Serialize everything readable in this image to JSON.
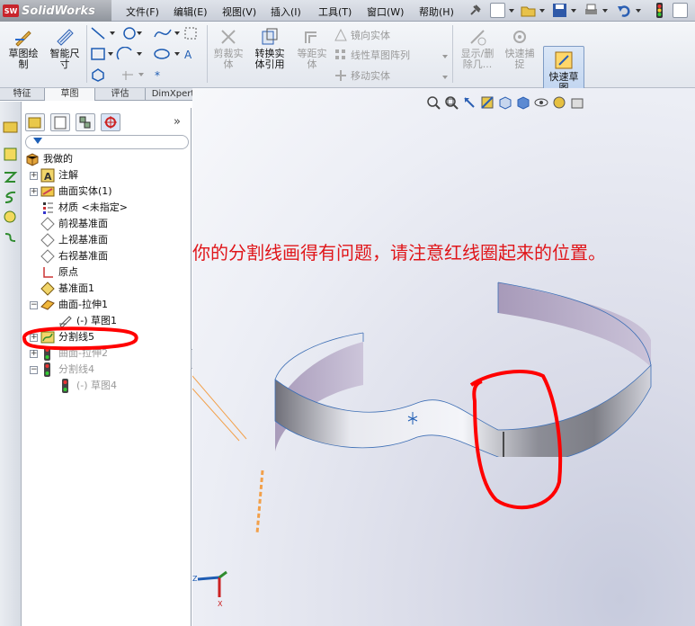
{
  "app": {
    "name": "SolidWorks",
    "logo_badge": "SW"
  },
  "menu": [
    "文件(F)",
    "编辑(E)",
    "视图(V)",
    "插入(I)",
    "工具(T)",
    "窗口(W)",
    "帮助(H)"
  ],
  "ribbon": {
    "sketch": "草图绘\n制",
    "smart_dim": "智能尺\n寸",
    "trim": "剪裁实\n体",
    "convert": "转换实\n体引用",
    "offset": "等距实\n体",
    "mirror": "镜向实体",
    "linear_pattern": "线性草图阵列",
    "move": "移动实体",
    "show_delete": "显示/删\n除几...",
    "quick_snap": "快速捕\n捉",
    "quick_sketch": "快速草\n图"
  },
  "tabs": [
    "特征",
    "草图",
    "评估",
    "DimXpert"
  ],
  "active_tab": "草图",
  "tree": {
    "root": "我做的",
    "items": [
      {
        "label": "注解",
        "state": "normal"
      },
      {
        "label": "曲面实体(1)",
        "state": "normal"
      },
      {
        "label": "材质 <未指定>",
        "state": "normal"
      },
      {
        "label": "前视基准面",
        "state": "normal"
      },
      {
        "label": "上视基准面",
        "state": "normal"
      },
      {
        "label": "右视基准面",
        "state": "normal"
      },
      {
        "label": "原点",
        "state": "normal"
      },
      {
        "label": "基准面1",
        "state": "normal"
      },
      {
        "label": "曲面-拉伸1",
        "state": "normal"
      },
      {
        "label": "(-) 草图1",
        "state": "normal"
      },
      {
        "label": "分割线5",
        "state": "highlighted"
      },
      {
        "label": "曲面-拉伸2",
        "state": "dim"
      },
      {
        "label": "分割线4",
        "state": "dim"
      },
      {
        "label": "(-) 草图4",
        "state": "dim"
      }
    ]
  },
  "annotation_text": "你的分割线画得有问题，请注意红线圈起来的位置。",
  "axis_labels": {
    "x": "X",
    "y": "Y",
    "z": "Z"
  },
  "colors": {
    "annotation": "#e0161a",
    "sketch_line": "#f2a04a",
    "highlight_mark": "#ff0000"
  }
}
